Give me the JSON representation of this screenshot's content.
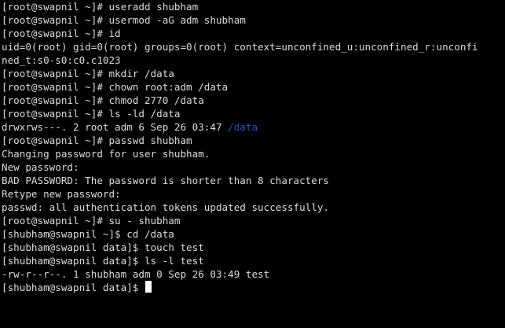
{
  "terminal": {
    "colors": {
      "background": "#000000",
      "foreground": "#dcdcdc",
      "directory": "#2a52be",
      "cursor": "#ffffff"
    },
    "lines": [
      "[root@swapnil ~]# useradd shubham",
      "[root@swapnil ~]# usermod -aG adm shubham",
      "[root@swapnil ~]# id",
      "uid=0(root) gid=0(root) groups=0(root) context=unconfined_u:unconfined_r:unconfi",
      "ned_t:s0-s0:c0.c1023",
      "[root@swapnil ~]# mkdir /data",
      "[root@swapnil ~]# chown root:adm /data",
      "[root@swapnil ~]# chmod 2770 /data",
      "[root@swapnil ~]# ls -ld /data",
      {
        "prefix": "drwxrws---. 2 root adm 6 Sep 26 03:47 ",
        "highlight": "/data"
      },
      "[root@swapnil ~]# passwd shubham",
      "Changing password for user shubham.",
      "New password:",
      "BAD PASSWORD: The password is shorter than 8 characters",
      "Retype new password:",
      "passwd: all authentication tokens updated successfully.",
      "[root@swapnil ~]# su - shubham",
      "[shubham@swapnil ~]$ cd /data",
      "[shubham@swapnil data]$ touch test",
      "[shubham@swapnil data]$ ls -l test",
      "-rw-r--r--. 1 shubham adm 0 Sep 26 03:49 test",
      "[shubham@swapnil data]$ "
    ]
  }
}
